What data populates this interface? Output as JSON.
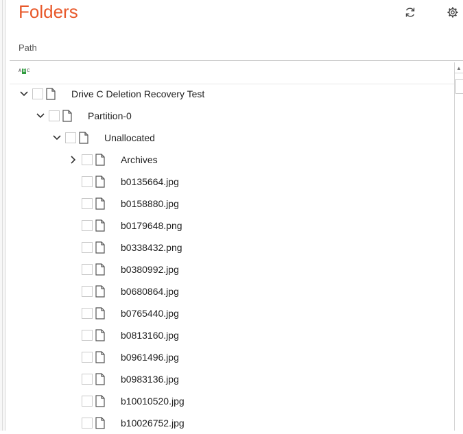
{
  "header": {
    "title": "Folders",
    "icons": [
      "refresh-icon",
      "settings-gear-icon"
    ],
    "accent": "#e8592b"
  },
  "columns": {
    "path_label": "Path",
    "filter_icon": "abc-filter-icon"
  },
  "tree": {
    "root": "Drive C Deletion Recovery Test",
    "partition": "Partition-0",
    "unallocated": "Unallocated",
    "archives": "Archives",
    "files": [
      "b0135664.jpg",
      "b0158880.jpg",
      "b0179648.png",
      "b0338432.png",
      "b0380992.jpg",
      "b0680864.jpg",
      "b0765440.jpg",
      "b0813160.jpg",
      "b0961496.jpg",
      "b0983136.jpg",
      "b10010520.jpg",
      "b10026752.jpg"
    ]
  }
}
